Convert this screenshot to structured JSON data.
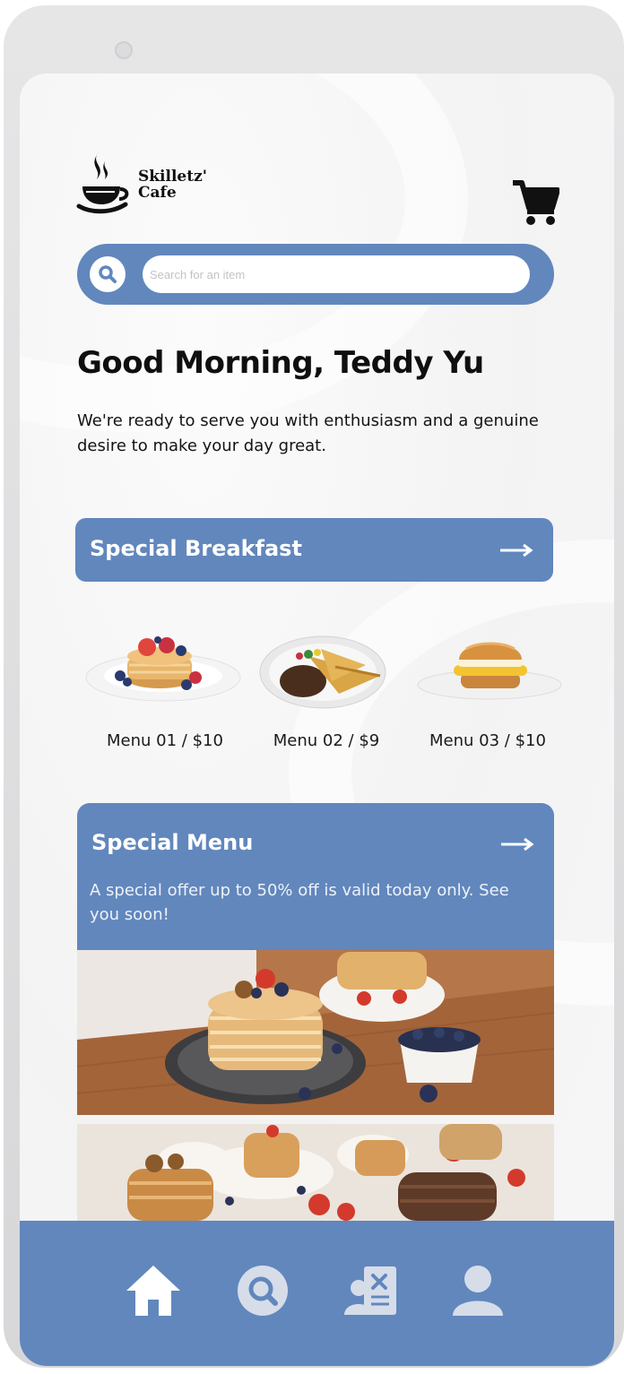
{
  "app": {
    "brand_line1": "Skilletz'",
    "brand_line2": "Cafe"
  },
  "header": {
    "logo_icon": "coffee-cup-logo",
    "cart_icon": "shopping-cart-icon"
  },
  "search": {
    "placeholder": "Search for an item",
    "value": "",
    "icon": "search-icon"
  },
  "greeting": {
    "title": "Good Morning, Teddy Yu",
    "subtitle": "We're ready to serve you with enthusiasm and a genuine desire to make your day great."
  },
  "special_breakfast": {
    "title": "Special Breakfast",
    "arrow_icon": "arrow-right-icon",
    "items": [
      {
        "label": "Menu 01 / $10",
        "image": "pancakes-with-berries"
      },
      {
        "label": "Menu 02 / $9",
        "image": "french-toast-plate"
      },
      {
        "label": "Menu 03 / $10",
        "image": "breakfast-sandwich"
      }
    ]
  },
  "special_menu": {
    "title": "Special Menu",
    "description": "A special offer up to 50% off is valid today only. See you soon!",
    "arrow_icon": "arrow-right-icon",
    "photos": [
      "pancake-stack-blueberries-photo",
      "pancake-table-spread-photo"
    ]
  },
  "bottom_nav": {
    "items": [
      {
        "icon": "home-icon",
        "active": true
      },
      {
        "icon": "search-icon",
        "active": false
      },
      {
        "icon": "menu-book-icon",
        "active": false
      },
      {
        "icon": "profile-icon",
        "active": false
      }
    ]
  },
  "colors": {
    "accent": "#6187bd",
    "nav_inactive": "#d6dde9",
    "text": "#111111"
  }
}
